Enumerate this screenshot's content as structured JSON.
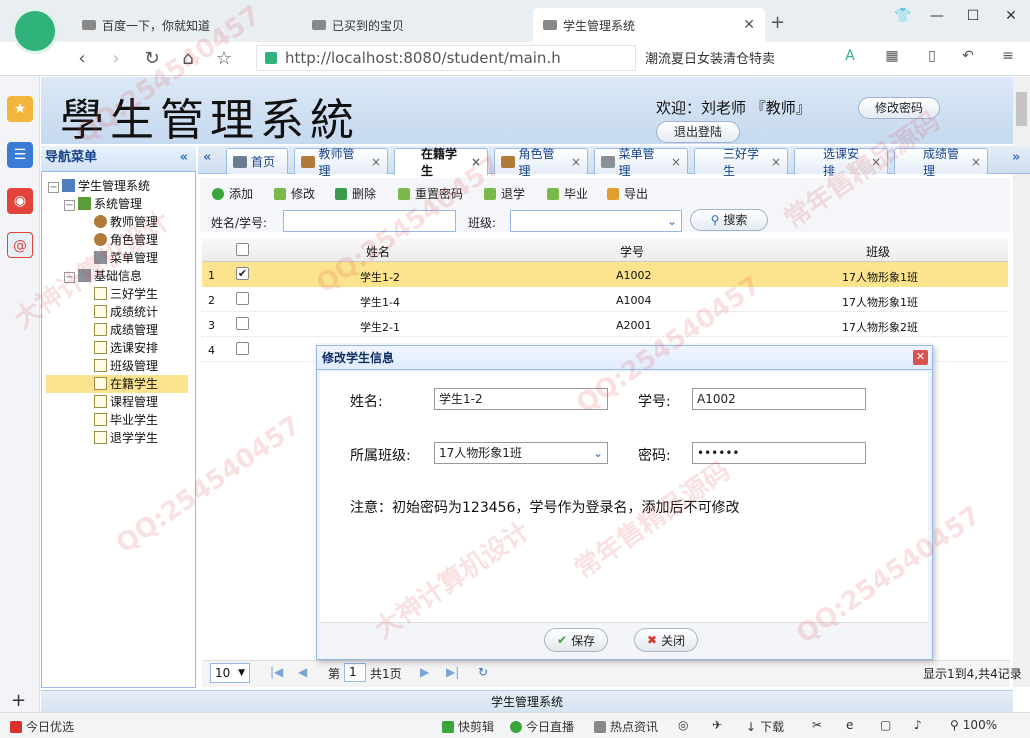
{
  "browser": {
    "tabs": [
      {
        "label": "百度一下，你就知道"
      },
      {
        "label": "已买到的宝贝"
      },
      {
        "label": "学生管理系统",
        "active": true
      }
    ],
    "new_tab": "+",
    "url": "http://localhost:8080/student/main.h",
    "hot_search": "潮流夏日女装清仓特卖"
  },
  "header": {
    "title": "學生管理系統",
    "welcome": "欢迎：刘老师 『教师』",
    "change_password": "修改密码",
    "logout": "退出登陆"
  },
  "nav": {
    "title": "导航菜单",
    "collapse": "«",
    "tree": {
      "root": "学生管理系统",
      "system_group": "系统管理",
      "system_items": [
        "教师管理",
        "角色管理",
        "菜单管理"
      ],
      "basic_group": "基础信息",
      "basic_items": [
        "三好学生",
        "成绩统计",
        "成绩管理",
        "选课安排",
        "班级管理",
        "在籍学生",
        "课程管理",
        "毕业学生",
        "退学学生"
      ]
    }
  },
  "app_tabs": [
    "首页",
    "教师管理",
    "在籍学生",
    "角色管理",
    "菜单管理",
    "三好学生",
    "选课安排",
    "成绩管理"
  ],
  "toolbar": {
    "buttons": [
      "添加",
      "修改",
      "删除",
      "重置密码",
      "退学",
      "毕业",
      "导出"
    ],
    "name_label": "姓名/学号:",
    "class_label": "班级:",
    "search": "搜索"
  },
  "grid": {
    "columns": [
      "姓名",
      "学号",
      "班级"
    ],
    "rows": [
      {
        "no": "1",
        "checked": true,
        "name": "学生1-2",
        "sid": "A1002",
        "cls": "17人物形象1班"
      },
      {
        "no": "2",
        "checked": false,
        "name": "学生1-4",
        "sid": "A1004",
        "cls": "17人物形象1班"
      },
      {
        "no": "3",
        "checked": false,
        "name": "学生2-1",
        "sid": "A2001",
        "cls": "17人物形象2班"
      },
      {
        "no": "4",
        "checked": false,
        "name": "",
        "sid": "",
        "cls": ""
      }
    ]
  },
  "dialog": {
    "title": "修改学生信息",
    "name_label": "姓名:",
    "name_value": "学生1-2",
    "sid_label": "学号:",
    "sid_value": "A1002",
    "class_label": "所属班级:",
    "class_value": "17人物形象1班",
    "pwd_label": "密码:",
    "pwd_value": "••••••",
    "note": "注意：初始密码为123456，学号作为登录名，添加后不可修改",
    "save": "保存",
    "close": "关闭"
  },
  "pager": {
    "page_size": "10",
    "page_prefix": "第",
    "page_no": "1",
    "page_total": "共1页",
    "summary": "显示1到4,共4记录"
  },
  "footer": "学生管理系统",
  "statusbar": {
    "left": "今日优选",
    "items": [
      "快剪辑",
      "今日直播",
      "热点资讯",
      "下载"
    ],
    "zoom": "100%"
  },
  "watermarks": [
    "QQ:254540457",
    "常年售精品源码",
    "大神计算机设计"
  ]
}
